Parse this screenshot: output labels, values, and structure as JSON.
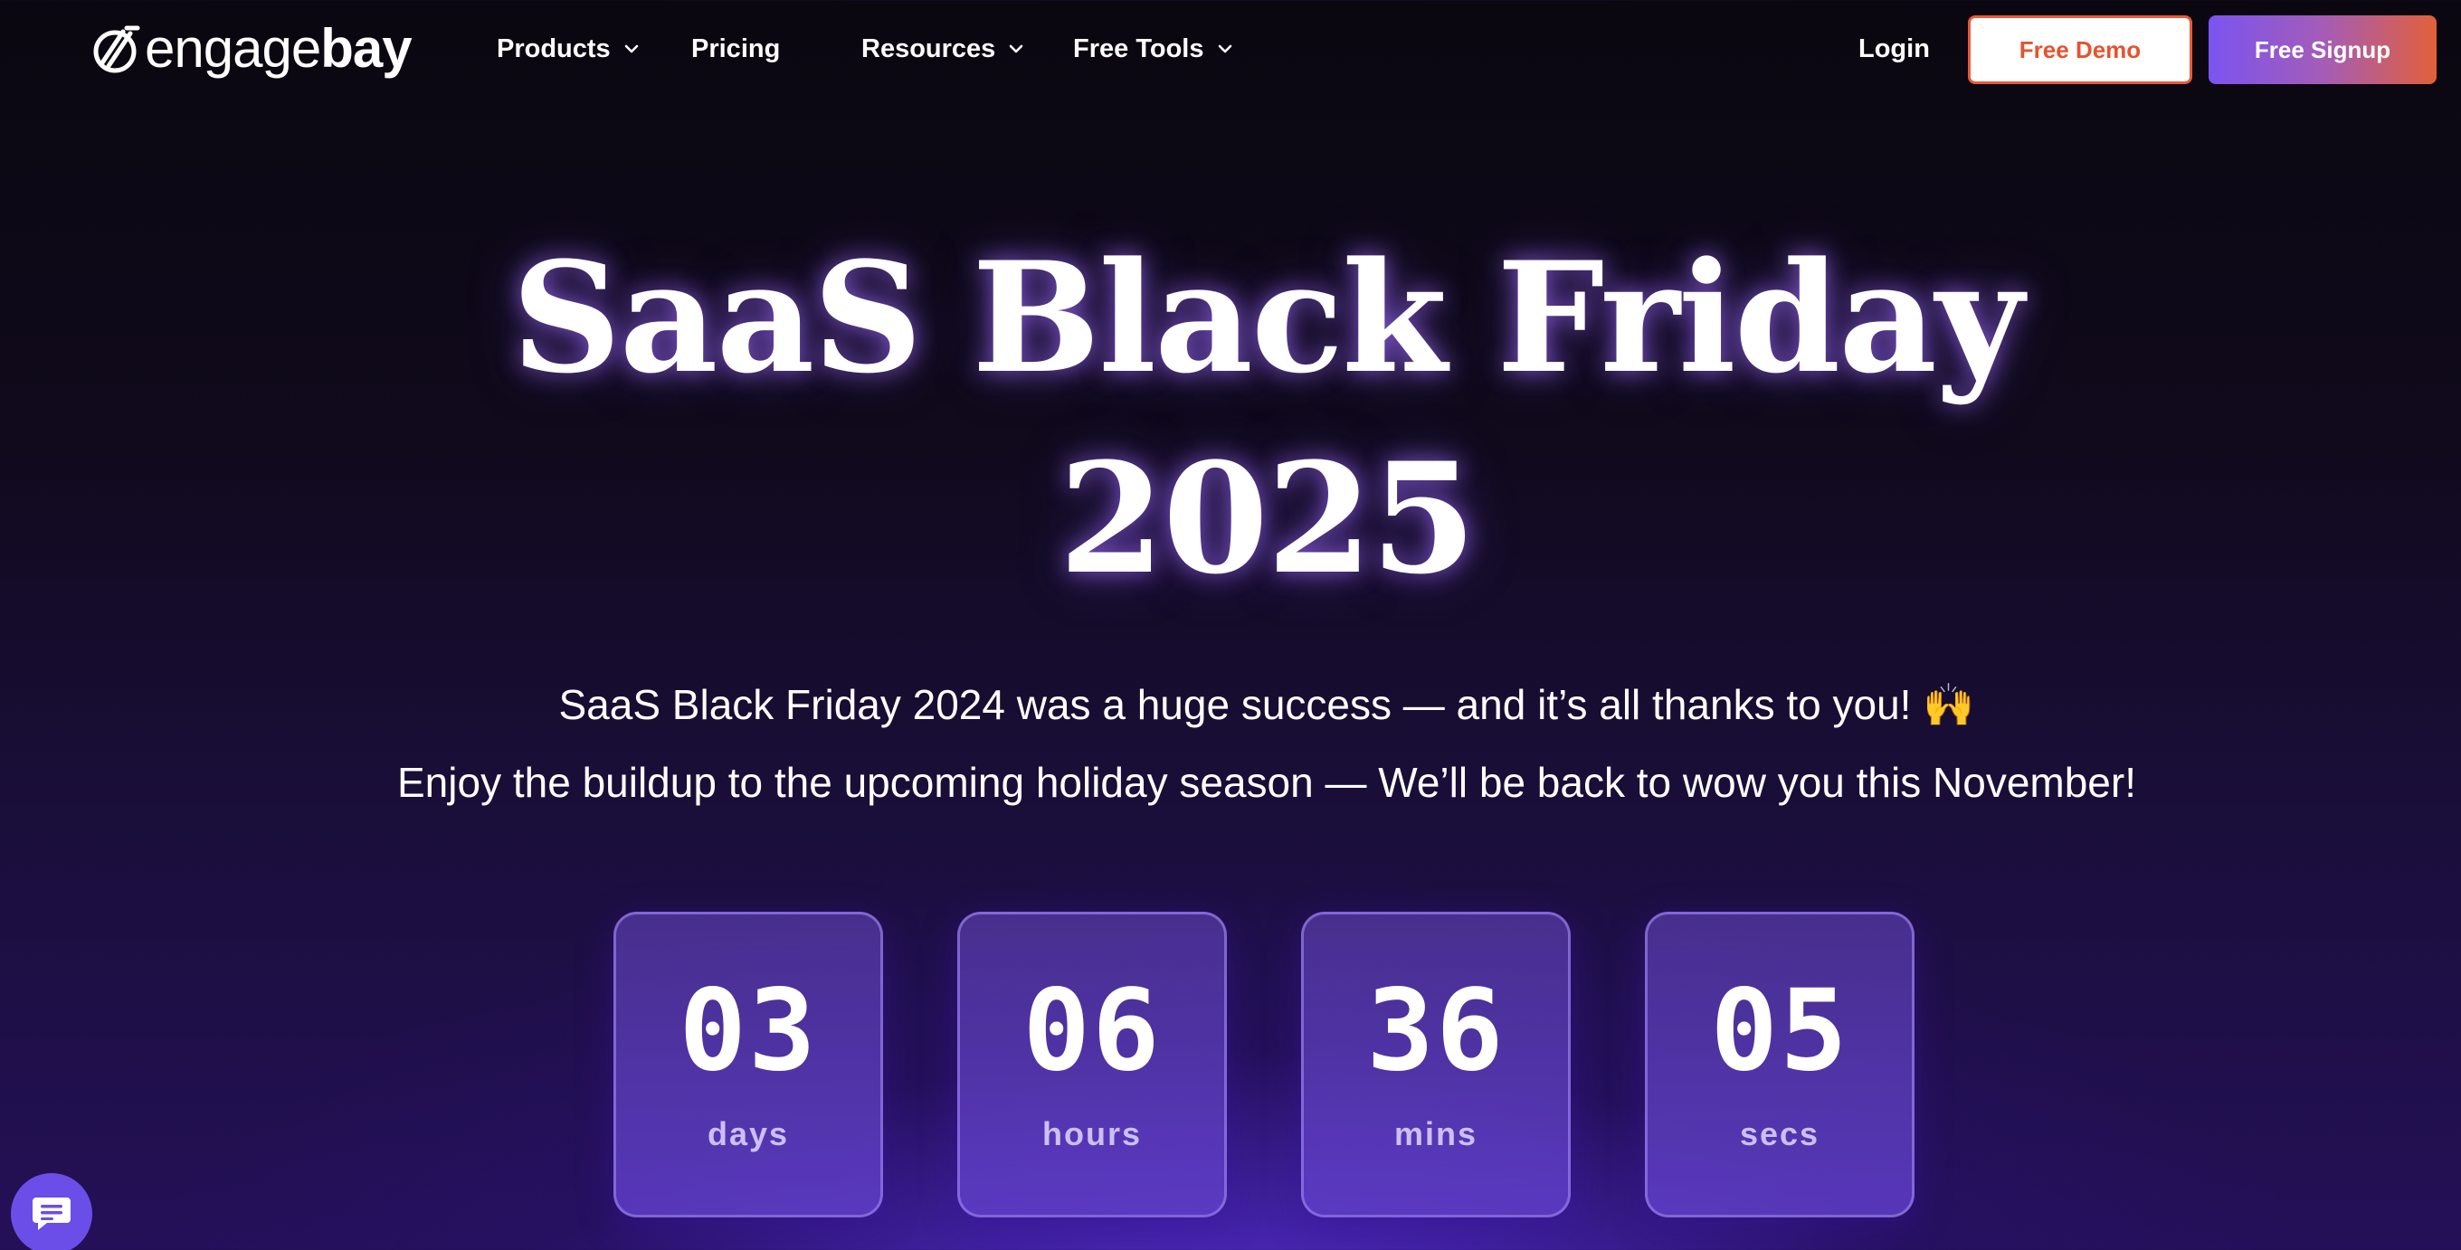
{
  "brand": {
    "name_light": "engage",
    "name_bold": "bay"
  },
  "nav": {
    "products": "Products",
    "pricing": "Pricing",
    "resources": "Resources",
    "free_tools": "Free Tools",
    "login": "Login",
    "free_demo": "Free Demo",
    "free_signup": "Free Signup"
  },
  "hero": {
    "title_line1": "SaaS Black Friday",
    "title_line2": "2025",
    "subtitle_line1": "SaaS Black Friday 2024 was a huge success — and it’s all thanks to you! 🙌",
    "subtitle_line2": "Enjoy the buildup to the upcoming holiday season — We’ll be back to wow you this November!"
  },
  "countdown": [
    {
      "value": "03",
      "label": "days"
    },
    {
      "value": "06",
      "label": "hours"
    },
    {
      "value": "36",
      "label": "mins"
    },
    {
      "value": "05",
      "label": "secs"
    }
  ],
  "colors": {
    "accent_orange": "#e5532f",
    "accent_purple": "#7b54f0",
    "chat_bubble": "#6b4ee8"
  },
  "icons": {
    "logo": "engagebay-logo-icon",
    "dropdown": "chevron-down-icon",
    "chat": "chat-bubble-icon"
  }
}
